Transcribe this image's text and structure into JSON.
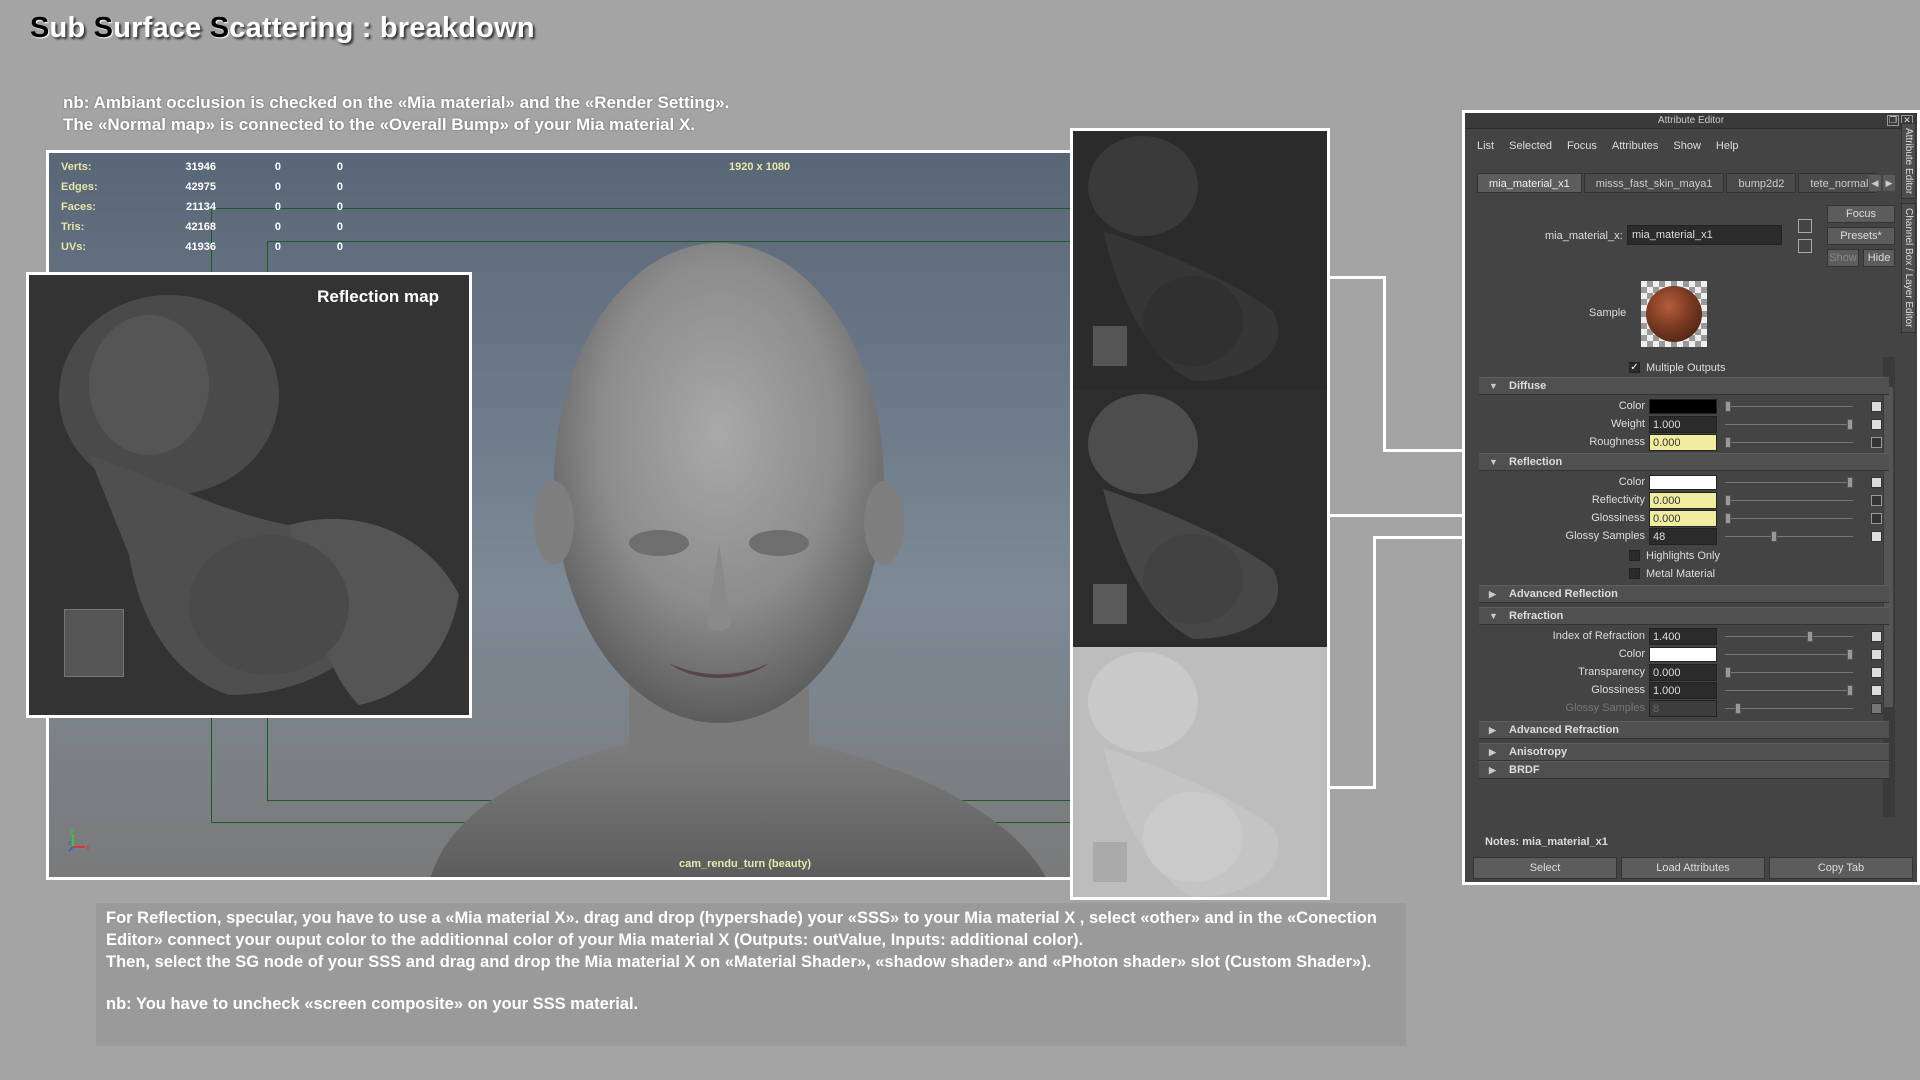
{
  "title": {
    "parts": [
      {
        "cap": "S",
        "rest": "ub "
      },
      {
        "cap": "S",
        "rest": "urface "
      },
      {
        "cap": "S",
        "rest": "cattering : breakdown"
      }
    ]
  },
  "note_top": {
    "line1": "nb: Ambiant occlusion is checked on the «Mia material» and the «Render Setting».",
    "line2": "The «Normal map» is connected to the «Overall Bump» of your Mia material X."
  },
  "viewport": {
    "stats": [
      {
        "label": "Verts:",
        "v1": "31946",
        "v2": "0",
        "v3": "0"
      },
      {
        "label": "Edges:",
        "v1": "42975",
        "v2": "0",
        "v3": "0"
      },
      {
        "label": "Faces:",
        "v1": "21134",
        "v2": "0",
        "v3": "0"
      },
      {
        "label": "Tris:",
        "v1": "42168",
        "v2": "0",
        "v3": "0"
      },
      {
        "label": "UVs:",
        "v1": "41936",
        "v2": "0",
        "v3": "0"
      }
    ],
    "resolution": "1920 x 1080",
    "camera": "cam_rendu_turn (beauty)",
    "axis": {
      "y": "y",
      "z": "z",
      "x": "x"
    }
  },
  "reflection_panel": {
    "label": "Reflection map"
  },
  "attribute_editor": {
    "window_title": "Attribute Editor",
    "menu": [
      "List",
      "Selected",
      "Focus",
      "Attributes",
      "Show",
      "Help"
    ],
    "tabs": [
      "mia_material_x1",
      "misss_fast_skin_maya1",
      "bump2d2",
      "tete_normalm"
    ],
    "vertical_tabs": [
      "Attribute Editor",
      "Channel Box / Layer Editor"
    ],
    "node_label": "mia_material_x:",
    "node_value": "mia_material_x1",
    "buttons": {
      "focus": "Focus",
      "presets": "Presets*",
      "show": "Show",
      "hide": "Hide"
    },
    "sample_label": "Sample",
    "multiple_outputs": "Multiple Outputs",
    "sections": {
      "diffuse": "Diffuse",
      "reflection": "Reflection",
      "advanced_reflection": "Advanced Reflection",
      "refraction": "Refraction",
      "advanced_refraction": "Advanced Refraction",
      "anisotropy": "Anisotropy",
      "brdf": "BRDF"
    },
    "diffuse": {
      "color_label": "Color",
      "color_hex": "#000000",
      "weight_label": "Weight",
      "weight": "1.000",
      "roughness_label": "Roughness",
      "roughness": "0.000"
    },
    "reflection": {
      "color_label": "Color",
      "color_hex": "#ffffff",
      "reflectivity_label": "Reflectivity",
      "reflectivity": "0.000",
      "glossiness_label": "Glossiness",
      "glossiness": "0.000",
      "glossy_samples_label": "Glossy Samples",
      "glossy_samples": "48",
      "highlights_only": "Highlights Only",
      "metal_material": "Metal Material"
    },
    "refraction": {
      "ior_label": "Index of Refraction",
      "ior": "1.400",
      "color_label": "Color",
      "color_hex": "#ffffff",
      "transparency_label": "Transparency",
      "transparency": "0.000",
      "glossiness_label": "Glossiness",
      "glossiness": "1.000",
      "glossy_samples_label": "Glossy Samples",
      "glossy_samples": "8"
    },
    "notes": "Notes: mia_material_x1",
    "bottom_buttons": [
      "Select",
      "Load Attributes",
      "Copy Tab"
    ]
  },
  "note_bottom": {
    "para1": "For Reflection, specular, you have to use a «Mia material X». drag and drop (hypershade) your «SSS» to your Mia material X , select «other» and in the «Conection Editor» connect your ouput color to the additionnal color of your Mia material X (Outputs: outValue, Inputs: additional color).",
    "para2": "Then, select the SG node of your SSS and drag and drop the Mia material X on «Material Shader», «shadow shader» and «Photon shader» slot (Custom Shader»).",
    "para3": "nb: You have to uncheck «screen composite» on your SSS material."
  },
  "colors": {
    "background": "#a4a4a4",
    "highlight_field": "#f0eda0",
    "stats_label": "#e6e6a8"
  }
}
